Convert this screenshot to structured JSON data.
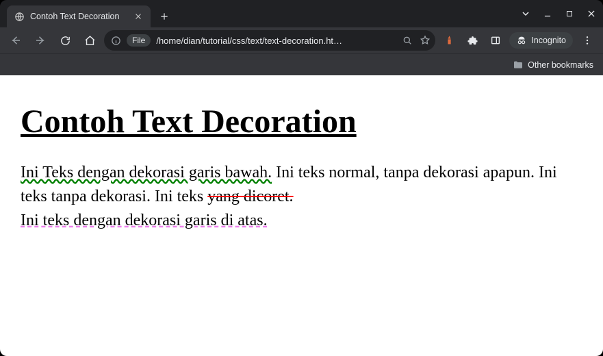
{
  "browser": {
    "tab_title": "Contoh Text Decoration",
    "url_scheme_label": "File",
    "url_path": "/home/dian/tutorial/css/text/text-decoration.ht…",
    "incognito_label": "Incognito",
    "bookmarks_folder": "Other bookmarks"
  },
  "page": {
    "heading": "Contoh Text Decoration",
    "span_underline_wavy": "Ini Teks dengan dekorasi garis bawah.",
    "span_normal_1": " Ini teks normal, tanpa dekorasi apapun. ",
    "span_no_decoration": "Ini teks tanpa dekorasi.",
    "span_strike_prefix": " Ini teks ",
    "span_strike": "yang dicoret.",
    "span_underline_dashed": "Ini teks dengan dekorasi garis di atas.",
    "span_overline": ""
  }
}
